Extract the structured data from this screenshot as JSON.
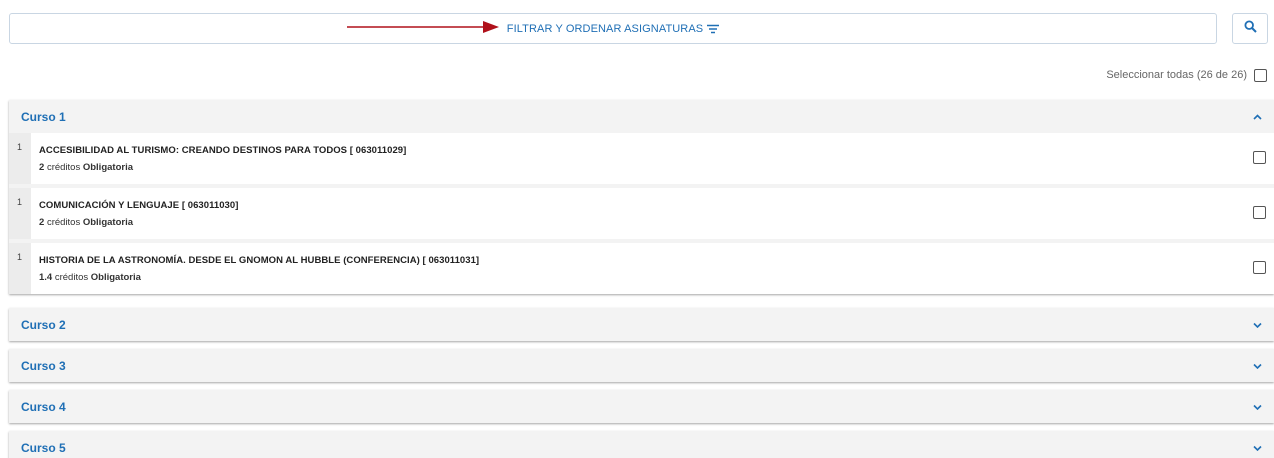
{
  "filter": {
    "label": "FILTRAR Y ORDENAR ASIGNATURAS",
    "icon": "filter-lines-icon",
    "accent": "#1f6fb5"
  },
  "search": {
    "icon": "search-icon"
  },
  "select_all": {
    "label": "Seleccionar todas (26 de 26)"
  },
  "credits_word": "créditos",
  "courses": [
    {
      "title": "Curso 1",
      "expanded": true,
      "subjects": [
        {
          "num": "1",
          "name": "ACCESIBILIDAD AL TURISMO: CREANDO DESTINOS PARA TODOS [ 063011029]",
          "credits": "2",
          "type": "Obligatoria"
        },
        {
          "num": "1",
          "name": "COMUNICACIÓN Y LENGUAJE [ 063011030]",
          "credits": "2",
          "type": "Obligatoria"
        },
        {
          "num": "1",
          "name": "HISTORIA DE LA ASTRONOMÍA. DESDE EL GNOMON AL HUBBLE (CONFERENCIA) [ 063011031]",
          "credits": "1.4",
          "type": "Obligatoria"
        }
      ]
    },
    {
      "title": "Curso 2",
      "expanded": false
    },
    {
      "title": "Curso 3",
      "expanded": false
    },
    {
      "title": "Curso 4",
      "expanded": false
    },
    {
      "title": "Curso 5",
      "expanded": false
    }
  ]
}
